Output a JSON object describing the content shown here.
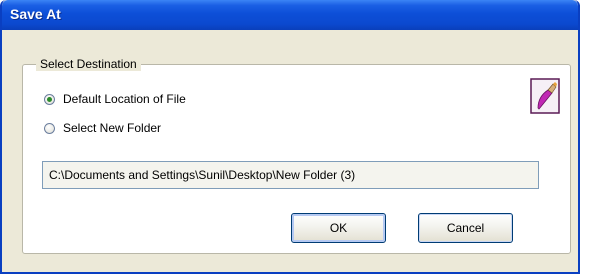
{
  "window": {
    "title": "Save At"
  },
  "group": {
    "legend": "Select Destination"
  },
  "options": [
    {
      "label": "Default Location of File",
      "checked": true
    },
    {
      "label": "Select New Folder",
      "checked": false
    }
  ],
  "path_field": {
    "value": "C:\\Documents and Settings\\Sunil\\Desktop\\New Folder (3)"
  },
  "buttons": {
    "ok_label": "OK",
    "cancel_label": "Cancel"
  },
  "icons": {
    "app_icon": "paint-brush-icon"
  },
  "colors": {
    "title_bar": "#0d4fd8",
    "window_bg": "#ece9d8",
    "accent_icon": "#c028b4"
  }
}
